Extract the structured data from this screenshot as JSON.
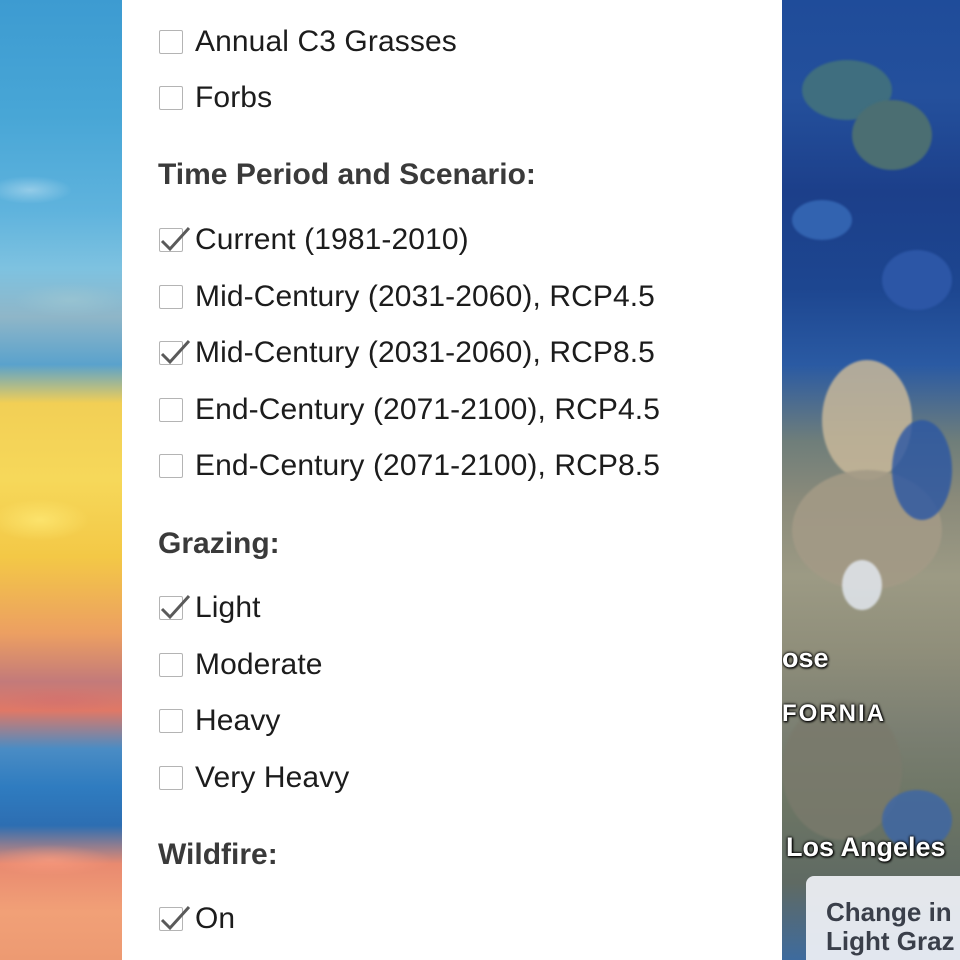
{
  "vegetation_options": [
    {
      "label": "Annual C3 Grasses",
      "checked": false
    },
    {
      "label": "Forbs",
      "checked": false
    }
  ],
  "time_period": {
    "title": "Time Period and Scenario:",
    "options": [
      {
        "label": "Current (1981-2010)",
        "checked": true
      },
      {
        "label": "Mid-Century (2031-2060), RCP4.5",
        "checked": false
      },
      {
        "label": "Mid-Century (2031-2060), RCP8.5",
        "checked": true
      },
      {
        "label": "End-Century (2071-2100), RCP4.5",
        "checked": false
      },
      {
        "label": "End-Century (2071-2100), RCP8.5",
        "checked": false
      }
    ]
  },
  "grazing": {
    "title": "Grazing:",
    "options": [
      {
        "label": "Light",
        "checked": true
      },
      {
        "label": "Moderate",
        "checked": false
      },
      {
        "label": "Heavy",
        "checked": false
      },
      {
        "label": "Very Heavy",
        "checked": false
      }
    ]
  },
  "wildfire": {
    "title": "Wildfire:",
    "options": [
      {
        "label": "On",
        "checked": true
      }
    ]
  },
  "map": {
    "labels": {
      "city_partial": "ose",
      "state_partial": "FORNIA",
      "los_angeles": "Los Angeles"
    },
    "legend_line1": "Change in",
    "legend_line2": "Light Graz"
  }
}
